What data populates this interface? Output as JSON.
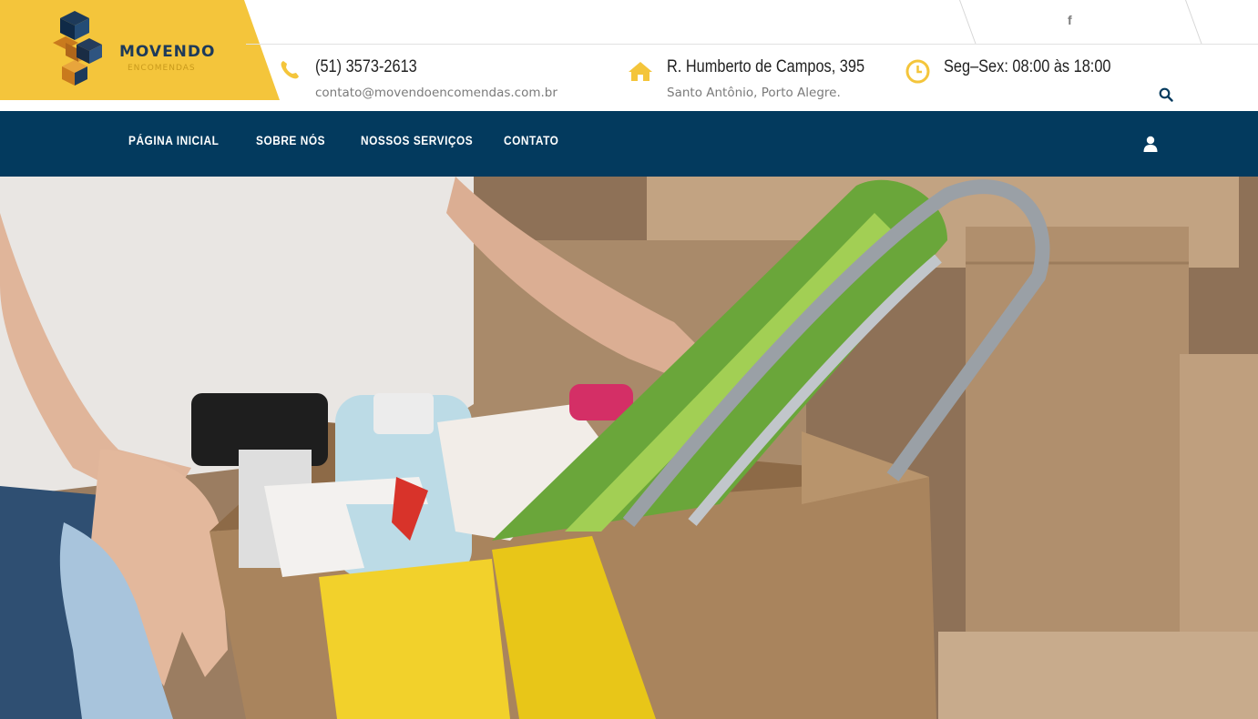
{
  "brand": {
    "name": "MOVENDO",
    "tagline": "ENCOMENDAS"
  },
  "topbar": {
    "social": [
      {
        "icon": "facebook-icon",
        "label": "f"
      }
    ]
  },
  "contact": {
    "phone": "(51) 3573-2613",
    "email": "contato@movendoencomendas.com.br",
    "address_line1": "R. Humberto de Campos, 395",
    "address_line2": "Santo Antônio, Porto Alegre.",
    "hours": "Seg–Sex: 08:00 às 18:00"
  },
  "nav": {
    "items": [
      {
        "label": "PÁGINA INICIAL"
      },
      {
        "label": "SOBRE NÓS"
      },
      {
        "label": "NOSSOS SERVIÇOS"
      },
      {
        "label": "CONTATO"
      }
    ]
  },
  "colors": {
    "accent": "#f4c53b",
    "nav_bg": "#033a5e",
    "logo_text": "#1d3a5a"
  },
  "hero": {
    "icon": "hero-photo-moving-box"
  }
}
